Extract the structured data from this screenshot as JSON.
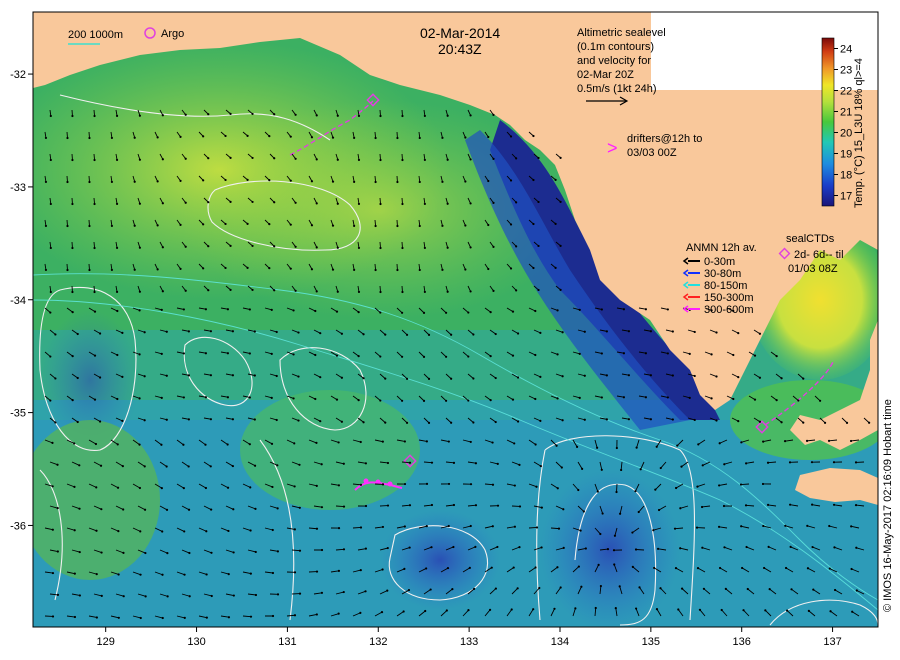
{
  "header": {
    "date": "02-Mar-2014",
    "time": "20:43Z"
  },
  "scale_legend": {
    "text": "200  1000m",
    "line_color": "#3ce0d0"
  },
  "argo_legend": {
    "text": "Argo",
    "color": "#e040e0"
  },
  "altimetry_note": {
    "lines": [
      "Altimetric sealevel",
      "(0.1m contours)",
      "and velocity for",
      "02-Mar 20Z",
      "0.5m/s (1kt 24h)"
    ]
  },
  "drifters_note": {
    "symbol": ">",
    "lines": [
      "drifters@12h to",
      "03/03 00Z"
    ],
    "color": "#ff20ff"
  },
  "anmn_legend": {
    "title": "ANMN 12h av.",
    "items": [
      {
        "label": "0-30m",
        "color": "#000000"
      },
      {
        "label": "30-80m",
        "color": "#1030ff"
      },
      {
        "label": "80-150m",
        "color": "#20e0e0"
      },
      {
        "label": "150-300m",
        "color": "#ff2020"
      },
      {
        "label": "300-600m",
        "color": "#ff20ff"
      }
    ]
  },
  "sealctd_legend": {
    "title": "sealCTDs",
    "line1": "2d- 6d-- til",
    "line2": "01/03 08Z",
    "color": "#e040e0"
  },
  "colorbar": {
    "title": "Temp. (°C) 15_L3U 18% ql>=4",
    "ticks": [
      "24",
      "23",
      "22",
      "21",
      "20",
      "19",
      "18",
      "17"
    ],
    "range": [
      16.5,
      24.5
    ]
  },
  "credit": "© IMOS 16-May-2017 02:16:09 Hobart time",
  "axes": {
    "x_ticks": [
      "129",
      "130",
      "131",
      "132",
      "133",
      "134",
      "135",
      "136",
      "137"
    ],
    "y_ticks": [
      "-32",
      "-33",
      "-34",
      "-35",
      "-36"
    ],
    "lon_range": [
      128.2,
      137.5
    ],
    "lat_range": [
      -36.9,
      -31.45
    ]
  },
  "colors": {
    "land": "#f9c89b",
    "ocean_warm": "#9ad43a",
    "ocean_mid": "#38b85a",
    "ocean_cool": "#2aa0d0",
    "ocean_cold": "#1c3a9a",
    "contour": "#f0f0f0",
    "isobath": "#60e8e0",
    "marker": "#e040e0"
  }
}
